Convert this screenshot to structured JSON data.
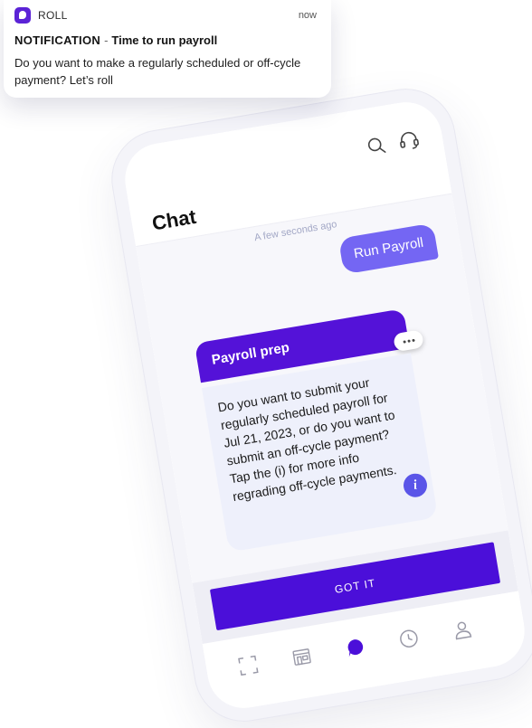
{
  "notification": {
    "app_name": "ROLL",
    "time": "now",
    "label": "NOTIFICATION",
    "separator": "-",
    "title": "Time to run payroll",
    "body": "Do you want to make a regularly scheduled or off-cycle payment? Let’s roll"
  },
  "header": {
    "title": "Chat",
    "icons": [
      "search-icon",
      "headset-icon"
    ]
  },
  "chat": {
    "timestamp": "A few seconds ago",
    "user_message": "Run Payroll",
    "bot_card": {
      "title": "Payroll prep",
      "more_icon": "ellipsis-icon",
      "body": "Do you want to submit your regularly scheduled payroll for Jul 21, 2023, or do you want to submit an off-cycle payment? Tap the (i) for more info regrading off-cycle payments.",
      "info_label": "i"
    }
  },
  "action": {
    "label": "GOT IT"
  },
  "tabbar": {
    "tabs": [
      {
        "icon": "scan-icon",
        "active": false
      },
      {
        "icon": "store-icon",
        "active": false
      },
      {
        "icon": "chat-bubble-icon",
        "active": true
      },
      {
        "icon": "clock-icon",
        "active": false
      },
      {
        "icon": "profile-icon",
        "active": false
      }
    ]
  },
  "colors": {
    "brand": "#5412d8",
    "user_bubble": "#7466f3",
    "button": "#4b0fd9",
    "info": "#5a55e8",
    "message_bg": "#eef0fb"
  }
}
